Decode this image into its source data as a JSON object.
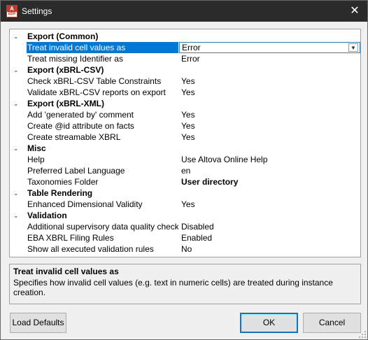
{
  "window": {
    "title": "Settings",
    "close_glyph": "✕",
    "icon_top": "A",
    "icon_bottom": "EBR"
  },
  "grid": {
    "expand_glyph": "⌄",
    "groups": [
      {
        "label": "Export (Common)",
        "items": [
          {
            "name": "Treat invalid cell values as",
            "value": "Error",
            "selected": true
          },
          {
            "name": "Treat missing Identifier as",
            "value": "Error"
          }
        ]
      },
      {
        "label": "Export (xBRL-CSV)",
        "items": [
          {
            "name": "Check xBRL-CSV Table Constraints",
            "value": "Yes"
          },
          {
            "name": "Validate xBRL-CSV reports on export",
            "value": "Yes"
          }
        ]
      },
      {
        "label": "Export (xBRL-XML)",
        "items": [
          {
            "name": "Add 'generated by' comment",
            "value": "Yes"
          },
          {
            "name": "Create @id attribute on facts",
            "value": "Yes"
          },
          {
            "name": "Create streamable XBRL",
            "value": "Yes"
          }
        ]
      },
      {
        "label": "Misc",
        "items": [
          {
            "name": "Help",
            "value": "Use Altova Online Help"
          },
          {
            "name": "Preferred Label Language",
            "value": "en"
          },
          {
            "name": "Taxonomies Folder",
            "value": "User directory",
            "bold": true
          }
        ]
      },
      {
        "label": "Table Rendering",
        "items": [
          {
            "name": "Enhanced Dimensional Validity",
            "value": "Yes"
          }
        ]
      },
      {
        "label": "Validation",
        "items": [
          {
            "name": "Additional supervisory data quality checks",
            "value": "Disabled"
          },
          {
            "name": "EBA XBRL Filing Rules",
            "value": "Enabled"
          },
          {
            "name": "Show all executed validation rules",
            "value": "No"
          }
        ]
      }
    ]
  },
  "description": {
    "title": "Treat invalid cell values as",
    "text": "Specifies how invalid cell values (e.g. text in numeric cells) are treated during instance creation."
  },
  "buttons": {
    "load_defaults": "Load Defaults",
    "ok": "OK",
    "cancel": "Cancel"
  }
}
